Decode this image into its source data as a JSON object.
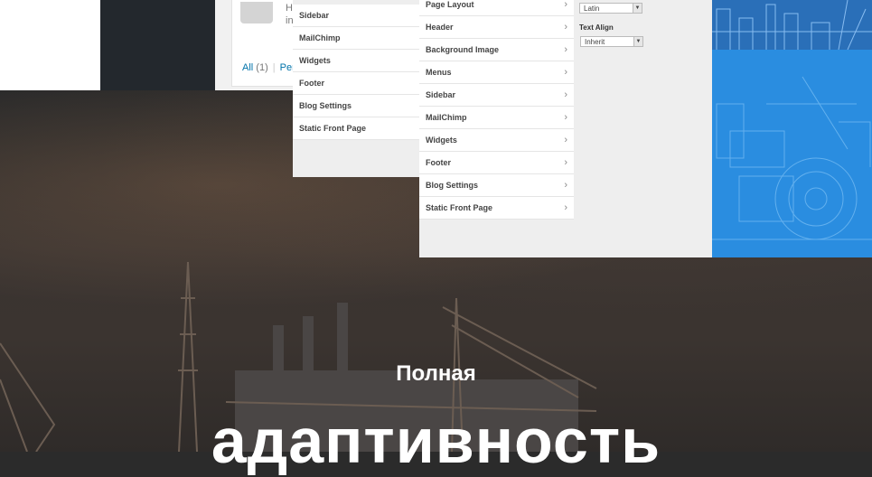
{
  "comments_card": {
    "snippet_line1": "H",
    "snippet_line2": "in",
    "all_label": "All",
    "all_count": "(1)",
    "separator": "|",
    "pending_label": "Per"
  },
  "customizer_back": {
    "menu_items": [
      "Sidebar",
      "MailChimp",
      "Widgets",
      "Footer",
      "Blog Settings",
      "Static Front Page"
    ]
  },
  "customizer_front": {
    "menu_items": [
      "Page Layout",
      "Header",
      "Background Image",
      "Menus",
      "Sidebar",
      "MailChimp",
      "Widgets",
      "Footer",
      "Blog Settings",
      "Static Front Page"
    ],
    "charset_select_value": "Latin",
    "text_align_label": "Text Align",
    "text_align_value": "Inherit"
  },
  "hero": {
    "subtitle": "Полная",
    "title": "адаптивность"
  },
  "colors": {
    "blueprint": "#2a8de0",
    "wp_admin_dark": "#23282d",
    "link": "#0073aa"
  },
  "icons": {
    "menu_chevron": "chevron-right-icon",
    "select_arrow": "caret-down-icon"
  }
}
